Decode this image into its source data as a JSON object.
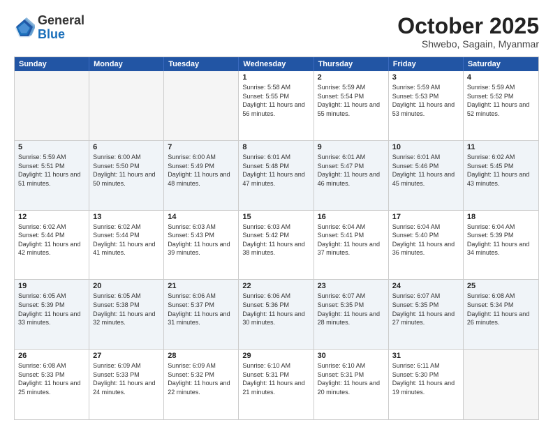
{
  "header": {
    "logo_general": "General",
    "logo_blue": "Blue",
    "month_title": "October 2025",
    "subtitle": "Shwebo, Sagain, Myanmar"
  },
  "weekdays": [
    "Sunday",
    "Monday",
    "Tuesday",
    "Wednesday",
    "Thursday",
    "Friday",
    "Saturday"
  ],
  "rows": [
    {
      "alt": false,
      "cells": [
        {
          "day": "",
          "sunrise": "",
          "sunset": "",
          "daylight": ""
        },
        {
          "day": "",
          "sunrise": "",
          "sunset": "",
          "daylight": ""
        },
        {
          "day": "",
          "sunrise": "",
          "sunset": "",
          "daylight": ""
        },
        {
          "day": "1",
          "sunrise": "Sunrise: 5:58 AM",
          "sunset": "Sunset: 5:55 PM",
          "daylight": "Daylight: 11 hours and 56 minutes."
        },
        {
          "day": "2",
          "sunrise": "Sunrise: 5:59 AM",
          "sunset": "Sunset: 5:54 PM",
          "daylight": "Daylight: 11 hours and 55 minutes."
        },
        {
          "day": "3",
          "sunrise": "Sunrise: 5:59 AM",
          "sunset": "Sunset: 5:53 PM",
          "daylight": "Daylight: 11 hours and 53 minutes."
        },
        {
          "day": "4",
          "sunrise": "Sunrise: 5:59 AM",
          "sunset": "Sunset: 5:52 PM",
          "daylight": "Daylight: 11 hours and 52 minutes."
        }
      ]
    },
    {
      "alt": true,
      "cells": [
        {
          "day": "5",
          "sunrise": "Sunrise: 5:59 AM",
          "sunset": "Sunset: 5:51 PM",
          "daylight": "Daylight: 11 hours and 51 minutes."
        },
        {
          "day": "6",
          "sunrise": "Sunrise: 6:00 AM",
          "sunset": "Sunset: 5:50 PM",
          "daylight": "Daylight: 11 hours and 50 minutes."
        },
        {
          "day": "7",
          "sunrise": "Sunrise: 6:00 AM",
          "sunset": "Sunset: 5:49 PM",
          "daylight": "Daylight: 11 hours and 48 minutes."
        },
        {
          "day": "8",
          "sunrise": "Sunrise: 6:01 AM",
          "sunset": "Sunset: 5:48 PM",
          "daylight": "Daylight: 11 hours and 47 minutes."
        },
        {
          "day": "9",
          "sunrise": "Sunrise: 6:01 AM",
          "sunset": "Sunset: 5:47 PM",
          "daylight": "Daylight: 11 hours and 46 minutes."
        },
        {
          "day": "10",
          "sunrise": "Sunrise: 6:01 AM",
          "sunset": "Sunset: 5:46 PM",
          "daylight": "Daylight: 11 hours and 45 minutes."
        },
        {
          "day": "11",
          "sunrise": "Sunrise: 6:02 AM",
          "sunset": "Sunset: 5:45 PM",
          "daylight": "Daylight: 11 hours and 43 minutes."
        }
      ]
    },
    {
      "alt": false,
      "cells": [
        {
          "day": "12",
          "sunrise": "Sunrise: 6:02 AM",
          "sunset": "Sunset: 5:44 PM",
          "daylight": "Daylight: 11 hours and 42 minutes."
        },
        {
          "day": "13",
          "sunrise": "Sunrise: 6:02 AM",
          "sunset": "Sunset: 5:44 PM",
          "daylight": "Daylight: 11 hours and 41 minutes."
        },
        {
          "day": "14",
          "sunrise": "Sunrise: 6:03 AM",
          "sunset": "Sunset: 5:43 PM",
          "daylight": "Daylight: 11 hours and 39 minutes."
        },
        {
          "day": "15",
          "sunrise": "Sunrise: 6:03 AM",
          "sunset": "Sunset: 5:42 PM",
          "daylight": "Daylight: 11 hours and 38 minutes."
        },
        {
          "day": "16",
          "sunrise": "Sunrise: 6:04 AM",
          "sunset": "Sunset: 5:41 PM",
          "daylight": "Daylight: 11 hours and 37 minutes."
        },
        {
          "day": "17",
          "sunrise": "Sunrise: 6:04 AM",
          "sunset": "Sunset: 5:40 PM",
          "daylight": "Daylight: 11 hours and 36 minutes."
        },
        {
          "day": "18",
          "sunrise": "Sunrise: 6:04 AM",
          "sunset": "Sunset: 5:39 PM",
          "daylight": "Daylight: 11 hours and 34 minutes."
        }
      ]
    },
    {
      "alt": true,
      "cells": [
        {
          "day": "19",
          "sunrise": "Sunrise: 6:05 AM",
          "sunset": "Sunset: 5:39 PM",
          "daylight": "Daylight: 11 hours and 33 minutes."
        },
        {
          "day": "20",
          "sunrise": "Sunrise: 6:05 AM",
          "sunset": "Sunset: 5:38 PM",
          "daylight": "Daylight: 11 hours and 32 minutes."
        },
        {
          "day": "21",
          "sunrise": "Sunrise: 6:06 AM",
          "sunset": "Sunset: 5:37 PM",
          "daylight": "Daylight: 11 hours and 31 minutes."
        },
        {
          "day": "22",
          "sunrise": "Sunrise: 6:06 AM",
          "sunset": "Sunset: 5:36 PM",
          "daylight": "Daylight: 11 hours and 30 minutes."
        },
        {
          "day": "23",
          "sunrise": "Sunrise: 6:07 AM",
          "sunset": "Sunset: 5:35 PM",
          "daylight": "Daylight: 11 hours and 28 minutes."
        },
        {
          "day": "24",
          "sunrise": "Sunrise: 6:07 AM",
          "sunset": "Sunset: 5:35 PM",
          "daylight": "Daylight: 11 hours and 27 minutes."
        },
        {
          "day": "25",
          "sunrise": "Sunrise: 6:08 AM",
          "sunset": "Sunset: 5:34 PM",
          "daylight": "Daylight: 11 hours and 26 minutes."
        }
      ]
    },
    {
      "alt": false,
      "cells": [
        {
          "day": "26",
          "sunrise": "Sunrise: 6:08 AM",
          "sunset": "Sunset: 5:33 PM",
          "daylight": "Daylight: 11 hours and 25 minutes."
        },
        {
          "day": "27",
          "sunrise": "Sunrise: 6:09 AM",
          "sunset": "Sunset: 5:33 PM",
          "daylight": "Daylight: 11 hours and 24 minutes."
        },
        {
          "day": "28",
          "sunrise": "Sunrise: 6:09 AM",
          "sunset": "Sunset: 5:32 PM",
          "daylight": "Daylight: 11 hours and 22 minutes."
        },
        {
          "day": "29",
          "sunrise": "Sunrise: 6:10 AM",
          "sunset": "Sunset: 5:31 PM",
          "daylight": "Daylight: 11 hours and 21 minutes."
        },
        {
          "day": "30",
          "sunrise": "Sunrise: 6:10 AM",
          "sunset": "Sunset: 5:31 PM",
          "daylight": "Daylight: 11 hours and 20 minutes."
        },
        {
          "day": "31",
          "sunrise": "Sunrise: 6:11 AM",
          "sunset": "Sunset: 5:30 PM",
          "daylight": "Daylight: 11 hours and 19 minutes."
        },
        {
          "day": "",
          "sunrise": "",
          "sunset": "",
          "daylight": ""
        }
      ]
    }
  ]
}
